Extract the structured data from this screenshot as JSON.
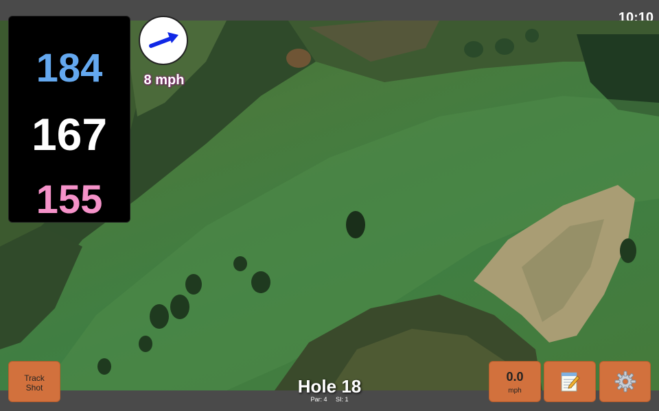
{
  "status": {
    "time": "10:10"
  },
  "distances": {
    "back": "184",
    "middle": "167",
    "front": "155"
  },
  "wind": {
    "speed_label": "8 mph",
    "icon": "wind-arrow-icon"
  },
  "hole": {
    "title": "Hole 18",
    "par": "Par: 4",
    "stroke_index": "SI: 1"
  },
  "buttons": {
    "track_shot": [
      "Track",
      "Shot"
    ],
    "speed_value": "0.0",
    "speed_unit": "mph",
    "notes_icon": "notepad-icon",
    "settings_icon": "gear-icon"
  },
  "colors": {
    "back": "#64a8ef",
    "middle": "#ffffff",
    "front": "#f592c9",
    "button": "#d2713d"
  }
}
